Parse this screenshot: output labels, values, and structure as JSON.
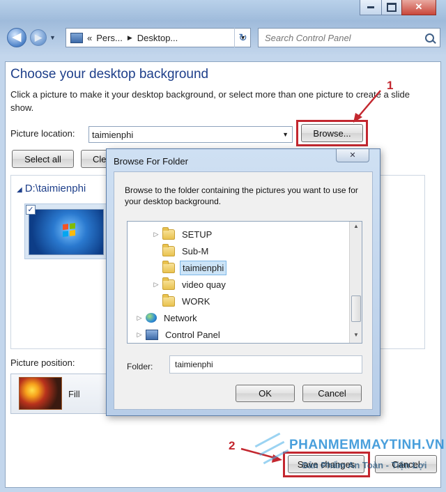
{
  "window": {
    "caption_buttons": [
      "minimize-icon",
      "maximize-icon",
      "close-icon"
    ]
  },
  "nav": {
    "breadcrumb_chevron": "«",
    "breadcrumb": [
      "Pers...",
      "Desktop..."
    ],
    "search_placeholder": "Search Control Panel"
  },
  "main": {
    "title": "Choose your desktop background",
    "description": "Click a picture to make it your desktop background, or select more than one picture to create a slide show.",
    "picture_location_label": "Picture location:",
    "picture_location_value": "taimienphi",
    "browse_label": "Browse...",
    "select_all_label": "Select all",
    "clear_all_label_partial": "Cle",
    "folder_heading": "D:\\taimienphi",
    "picture_position_label": "Picture position:",
    "position_value": "Fill",
    "save_changes_label": "Save changes",
    "cancel_label": "Cancel"
  },
  "dialog": {
    "title": "Browse For Folder",
    "instructions": "Browse to the folder containing the pictures you want to use for your desktop background.",
    "tree": [
      {
        "label": "SETUP",
        "indent": 1,
        "expandable": true,
        "selected": false,
        "icon": "folder-icon"
      },
      {
        "label": "Sub-M",
        "indent": 1,
        "expandable": false,
        "selected": false,
        "icon": "folder-icon"
      },
      {
        "label": "taimienphi",
        "indent": 1,
        "expandable": false,
        "selected": true,
        "icon": "folder-icon"
      },
      {
        "label": "video quay",
        "indent": 1,
        "expandable": true,
        "selected": false,
        "icon": "folder-icon"
      },
      {
        "label": "WORK",
        "indent": 1,
        "expandable": false,
        "selected": false,
        "icon": "folder-icon"
      },
      {
        "label": "Network",
        "indent": 0,
        "expandable": true,
        "selected": false,
        "icon": "network-icon"
      },
      {
        "label": "Control Panel",
        "indent": 0,
        "expandable": true,
        "selected": false,
        "icon": "control-panel-icon"
      }
    ],
    "folder_label": "Folder:",
    "folder_value": "taimienphi",
    "ok_label": "OK",
    "cancel_label": "Cancel",
    "close_glyph": "✕"
  },
  "annotations": {
    "step1": "1",
    "step2": "2",
    "color": "#c3272f"
  },
  "watermark": {
    "text": "PHANMEMMAYTINH.VN",
    "subtext": "Sản Phẩm An Toàn - Tiện Lợi"
  },
  "colors": {
    "title_blue": "#1e3f8a",
    "annotation_red": "#c3272f",
    "selection": "#cce4f7"
  }
}
